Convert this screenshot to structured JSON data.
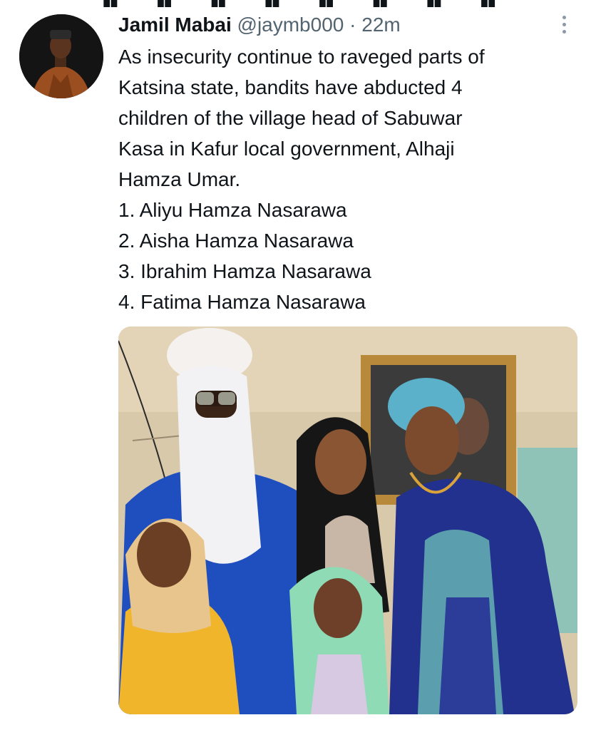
{
  "tweet": {
    "author_name": "Jamil Mabai",
    "author_handle": "@jaymb000",
    "separator": "·",
    "time": "22m",
    "text_lines": [
      "As insecurity continue to raveged parts of",
      "Katsina state, bandits have abducted 4",
      "children of the village head of Sabuwar",
      "Kasa in Kafur local government, Alhaji",
      "Hamza Umar.",
      "1. Aliyu Hamza Nasarawa",
      "2. Aisha Hamza Nasarawa",
      "3. Ibrahim Hamza Nasarawa",
      "4. Fatima Hamza Nasarawa"
    ],
    "more_icon": "more-vertical-icon"
  },
  "colors": {
    "text": "#0f1419",
    "secondary": "#536471"
  }
}
